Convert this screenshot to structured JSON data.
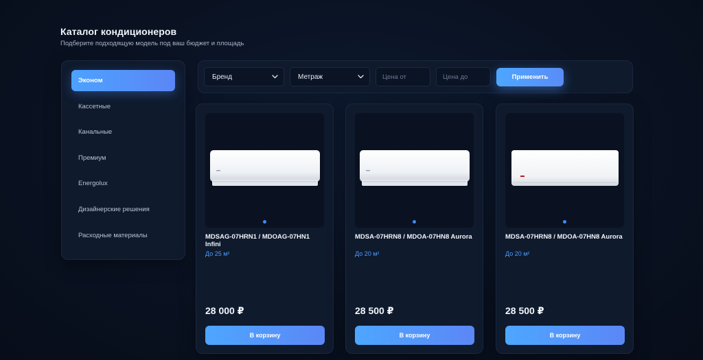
{
  "header": {
    "title": "Каталог кондиционеров",
    "subtitle": "Подберите подходящую модель под ваш бюджет и площадь"
  },
  "sidebar": {
    "items": [
      {
        "label": "Эконом",
        "active": true
      },
      {
        "label": "Кассетные",
        "active": false
      },
      {
        "label": "Канальные",
        "active": false
      },
      {
        "label": "Премиум",
        "active": false
      },
      {
        "label": "Energolux",
        "active": false
      },
      {
        "label": "Дизайнерские решения",
        "active": false
      },
      {
        "label": "Расходные материалы",
        "active": false
      }
    ]
  },
  "filters": {
    "brand_label": "Бренд",
    "area_label": "Метраж",
    "price_from_placeholder": "Цена от",
    "price_to_placeholder": "Цена до",
    "apply_label": "Применить"
  },
  "products": [
    {
      "name": "MDSAG-07HRN1 / MDOAG-07HN1 Infini",
      "area": "До 25 м²",
      "price": "28 000 ₽",
      "cart_label": "В корзину"
    },
    {
      "name": "MDSA-07HRN8 / MDOA-07HN8 Aurora",
      "area": "До 20 м²",
      "price": "28 500 ₽",
      "cart_label": "В корзину"
    },
    {
      "name": "MDSA-07HRN8 / MDOA-07HN8 Aurora",
      "area": "До 20 м²",
      "price": "28 500 ₽",
      "cart_label": "В корзину"
    }
  ],
  "colors": {
    "accent": "#4da2ff",
    "background": "#0a1222",
    "panel": "#0f1a2d",
    "area_text": "#4d9cff"
  },
  "icons": {
    "select_chevron": "chevron-down-icon",
    "carousel_dot": "carousel-dot"
  }
}
